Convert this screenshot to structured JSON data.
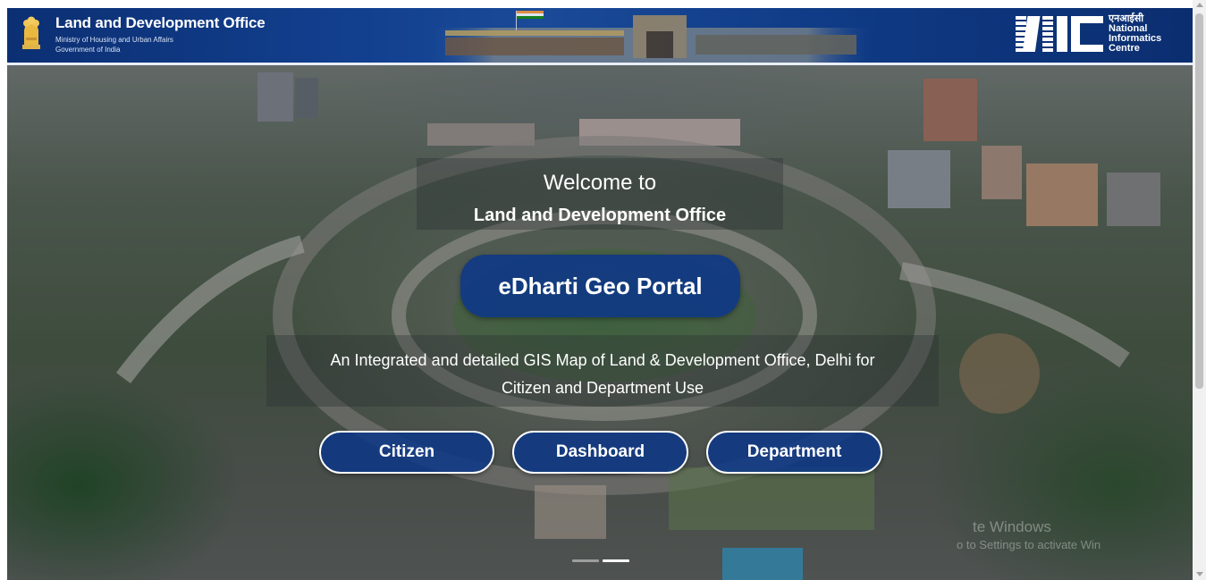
{
  "header": {
    "title": "Land and Development Office",
    "subtitle_ministry": "Ministry of Housing and Urban Affairs",
    "subtitle_government": "Government of India",
    "nic": {
      "hindi": "एनआईसी",
      "line1": "National",
      "line2": "Informatics",
      "line3": "Centre"
    }
  },
  "hero": {
    "welcome_line1": "Welcome to",
    "welcome_line2": "Land and Development Office",
    "portal_button": "eDharti Geo Portal",
    "description_line1": "An Integrated and detailed GIS Map of Land & Development Office, Delhi for",
    "description_line2": "Citizen and Department Use",
    "buttons": {
      "citizen": "Citizen",
      "dashboard": "Dashboard",
      "department": "Department"
    },
    "slides_total": 2,
    "active_slide": 2
  },
  "watermark": {
    "line1": "te Windows",
    "line2": "o to Settings to activate Win"
  },
  "colors": {
    "header_blue": "#12408f",
    "button_blue": "#0c3787",
    "text_white": "#ffffff"
  },
  "icons": [
    "national-emblem-icon",
    "nic-logo-icon",
    "scroll-up-arrow-icon",
    "scroll-down-arrow-icon"
  ]
}
